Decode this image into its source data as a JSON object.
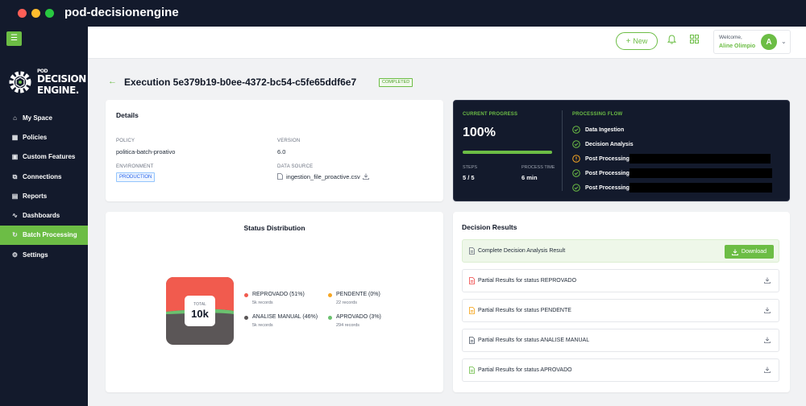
{
  "window": {
    "title": "pod-decisionengine"
  },
  "logo": {
    "line1": "POD",
    "line2": "DECISION",
    "line3": "ENGINE."
  },
  "sidebar": {
    "items": [
      {
        "label": "My Space",
        "icon": "home-icon"
      },
      {
        "label": "Policies",
        "icon": "policy-icon"
      },
      {
        "label": "Custom Features",
        "icon": "features-icon"
      },
      {
        "label": "Connections",
        "icon": "connections-icon"
      },
      {
        "label": "Reports",
        "icon": "reports-icon"
      },
      {
        "label": "Dashboards",
        "icon": "dashboards-icon"
      },
      {
        "label": "Batch Processing",
        "icon": "batch-icon",
        "active": true
      },
      {
        "label": "Settings",
        "icon": "settings-icon"
      }
    ]
  },
  "header": {
    "new_label": "New",
    "welcome_label": "Welcome,",
    "user_name": "Aline Olimpio",
    "avatar_initial": "A"
  },
  "execution": {
    "title": "Execution 5e379b19-b0ee-4372-bc54-c5fe65ddf6e7",
    "status": "COMPLETED"
  },
  "details": {
    "title": "Details",
    "policy_label": "POLICY",
    "policy_value": "politica-batch-proativo",
    "version_label": "VERSION",
    "version_value": "6.0",
    "environment_label": "ENVIRONMENT",
    "environment_value": "PRODUCTION",
    "datasource_label": "DATA SOURCE",
    "datasource_value": "ingestion_file_proactive.csv"
  },
  "progress": {
    "title": "CURRENT PROGRESS",
    "percent_text": "100%",
    "percent": 1.0,
    "steps_label": "STEPS",
    "steps_value": "5 / 5",
    "time_label": "PROCESS TIME",
    "time_value": "6 min",
    "flow_title": "PROCESSING FLOW",
    "flow": [
      {
        "label": "Data Ingestion",
        "state": "done"
      },
      {
        "label": "Decision Analysis",
        "state": "done"
      },
      {
        "label": "Post Processing:",
        "state": "warning"
      },
      {
        "label": "Post Processing:",
        "state": "done"
      },
      {
        "label": "Post Processing:",
        "state": "done"
      }
    ]
  },
  "status_distribution": {
    "title": "Status Distribution",
    "total_label": "TOTAL",
    "total_value": "10k",
    "items": [
      {
        "name": "REPROVADO (51%)",
        "count": "5k records",
        "color": "#f15b4e",
        "share": 51
      },
      {
        "name": "PENDENTE (0%)",
        "count": "22 records",
        "color": "#f6a623",
        "share": 0
      },
      {
        "name": "ANALISE MANUAL (46%)",
        "count": "5k records",
        "color": "#5b5657",
        "share": 46
      },
      {
        "name": "APROVADO (3%)",
        "count": "294 records",
        "color": "#6bc16f",
        "share": 3
      }
    ]
  },
  "decision_results": {
    "title": "Decision Results",
    "download_label": "Download",
    "rows": [
      {
        "label": "Complete Decision Analysis Result",
        "icon_color": "#6b7280"
      },
      {
        "label": "Partial Results for status REPROVADO",
        "icon_color": "#ef4444"
      },
      {
        "label": "Partial Results for status PENDENTE",
        "icon_color": "#f59e0b"
      },
      {
        "label": "Partial Results for status ANALISE MANUAL",
        "icon_color": "#4b5563"
      },
      {
        "label": "Partial Results for status APROVADO",
        "icon_color": "#6cbd45"
      }
    ]
  },
  "colors": {
    "accent": "#6cbd45",
    "dark": "#131a2c"
  }
}
